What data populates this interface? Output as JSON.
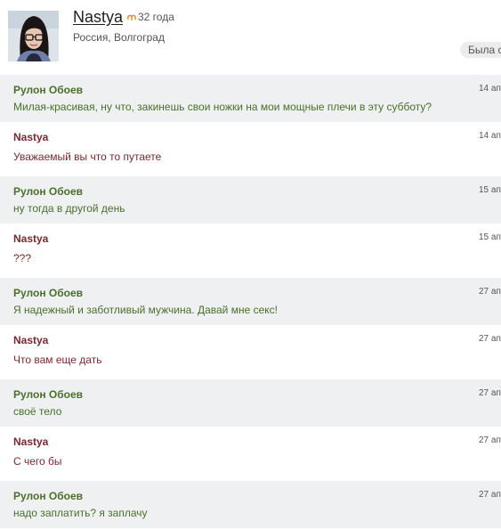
{
  "profile": {
    "name": "Nastya",
    "age": "32 года",
    "location": "Россия, Волгоград",
    "status": "Была с",
    "zodiac_icon": "aries-icon",
    "zodiac_color": "#e8923a"
  },
  "messages": [
    {
      "sender": "Рулон Обоев",
      "text": "Милая-красивая, ну что, закинешь свои ножки на мои мощные плечи в эту субботу?",
      "date": "14 ап"
    },
    {
      "sender": "Nastya",
      "text": "Уважаемый вы что то путаете",
      "date": "14 ап"
    },
    {
      "sender": "Рулон Обоев",
      "text": "ну тогда в другой день",
      "date": "15 ап"
    },
    {
      "sender": "Nastya",
      "text": "???",
      "date": "15 ап"
    },
    {
      "sender": "Рулон Обоев",
      "text": "Я надежный и заботливый мужчина. Давай мне секс!",
      "date": "27 ап"
    },
    {
      "sender": "Nastya",
      "text": "Что вам еще дать",
      "date": "27 ап"
    },
    {
      "sender": "Рулон Обоев",
      "text": "своё тело",
      "date": "27 ап"
    },
    {
      "sender": "Nastya",
      "text": "С чего бы",
      "date": "27 ап"
    },
    {
      "sender": "Рулон Обоев",
      "text": "надо заплатить? я заплачу",
      "date": "27 ап"
    }
  ],
  "colors": {
    "male_sender": "#4b6f2a",
    "female_sender": "#7a2730",
    "row_gray": "#eef0f2"
  }
}
